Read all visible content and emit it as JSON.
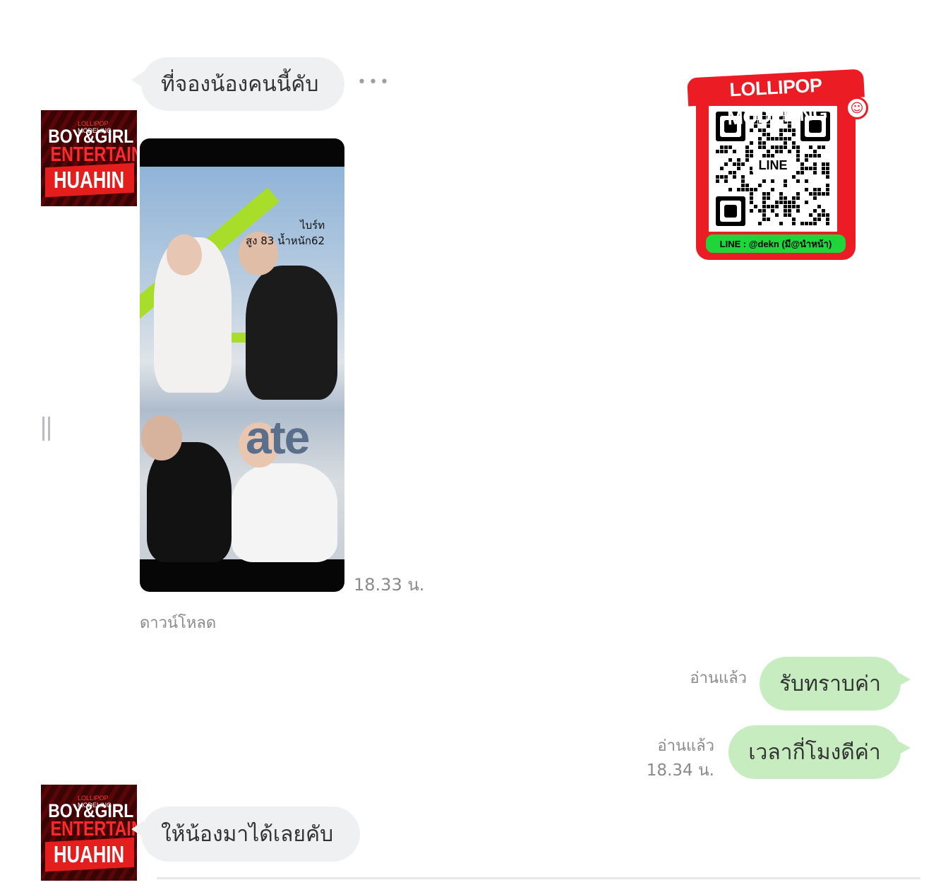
{
  "conversation": {
    "messages": [
      {
        "sender": "them",
        "text": "ที่จองน้องคนนี้คับ"
      },
      {
        "sender": "them",
        "type": "image",
        "time": "18.33 น.",
        "download_label": "ดาวน์โหลด",
        "photo_caption": "ไบร์ท\nสูง 83 น้ำหนัก62",
        "photo_sign": "ate"
      },
      {
        "sender": "me",
        "text": "รับทราบค่า",
        "read": "อ่านแล้ว"
      },
      {
        "sender": "me",
        "text": "เวลากี่โมงดีค่า",
        "read": "อ่านแล้ว",
        "time": "18.34 น."
      },
      {
        "sender": "them",
        "text": "ให้น้องมาได้เลยคับ"
      }
    ],
    "more_icon": "more-dots-icon",
    "side_icon": "pause-bar-icon"
  },
  "avatar": {
    "top_small_1": "LOLLIPOP",
    "top_small_2": "MODELING",
    "line1": "BOY&GIRL",
    "line2": "ENTERTAIN",
    "line3": "HUAHIN",
    "colors": {
      "bg": "#3a0304",
      "accent": "#e41d1d"
    }
  },
  "qr_card": {
    "banner": "LOLLIPOP MODELING",
    "center_label": "LINE",
    "footer": "LINE :  @dekn (มี@นำหน้า)",
    "colors": {
      "frame": "#ec1c24",
      "footer": "#1fd63a"
    }
  },
  "colors": {
    "incoming_bubble": "#eff0f2",
    "outgoing_bubble": "#c7ecc0"
  }
}
